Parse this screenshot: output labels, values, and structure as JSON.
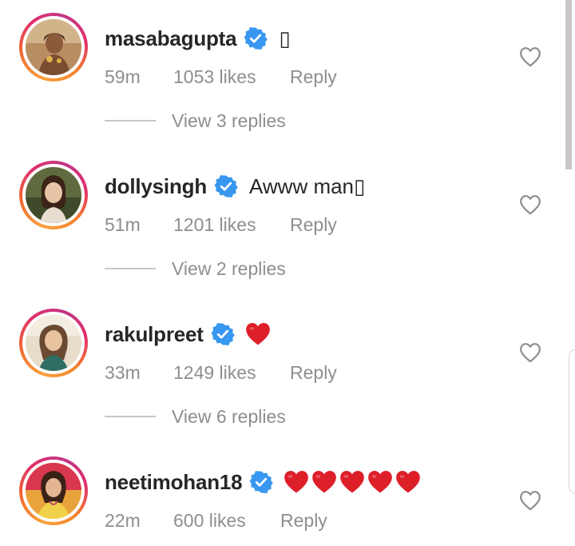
{
  "comments": [
    {
      "username": "masabagupta",
      "text": "",
      "trailing_glyph": "▯",
      "time": "59m",
      "likes": "1053 likes",
      "reply": "Reply",
      "view_replies": "View 3 replies",
      "avatar_theme": "warm-gold"
    },
    {
      "username": "dollysingh",
      "text": "Awww man",
      "trailing_glyph": "▯",
      "time": "51m",
      "likes": "1201 likes",
      "reply": "Reply",
      "view_replies": "View 2 replies",
      "avatar_theme": "green-garden"
    },
    {
      "username": "rakulpreet",
      "text": "",
      "hearts": 1,
      "time": "33m",
      "likes": "1249 likes",
      "reply": "Reply",
      "view_replies": "View 6 replies",
      "avatar_theme": "soft-daylight"
    },
    {
      "username": "neetimohan18",
      "text": "",
      "hearts": 5,
      "time": "22m",
      "likes": "600 likes",
      "reply": "Reply",
      "avatar_theme": "pink-yellow"
    }
  ],
  "icons": {
    "verified": "verified-badge-icon",
    "like": "heart-outline-icon",
    "emoji_heart": "red-heart-emoji"
  },
  "colors": {
    "verified_blue": "#3897f0",
    "heart_red": "#dd1f2a",
    "muted_text": "#8e8e8e",
    "primary_text": "#262626",
    "ring_start": "#f9a13f",
    "ring_end": "#c13584"
  }
}
